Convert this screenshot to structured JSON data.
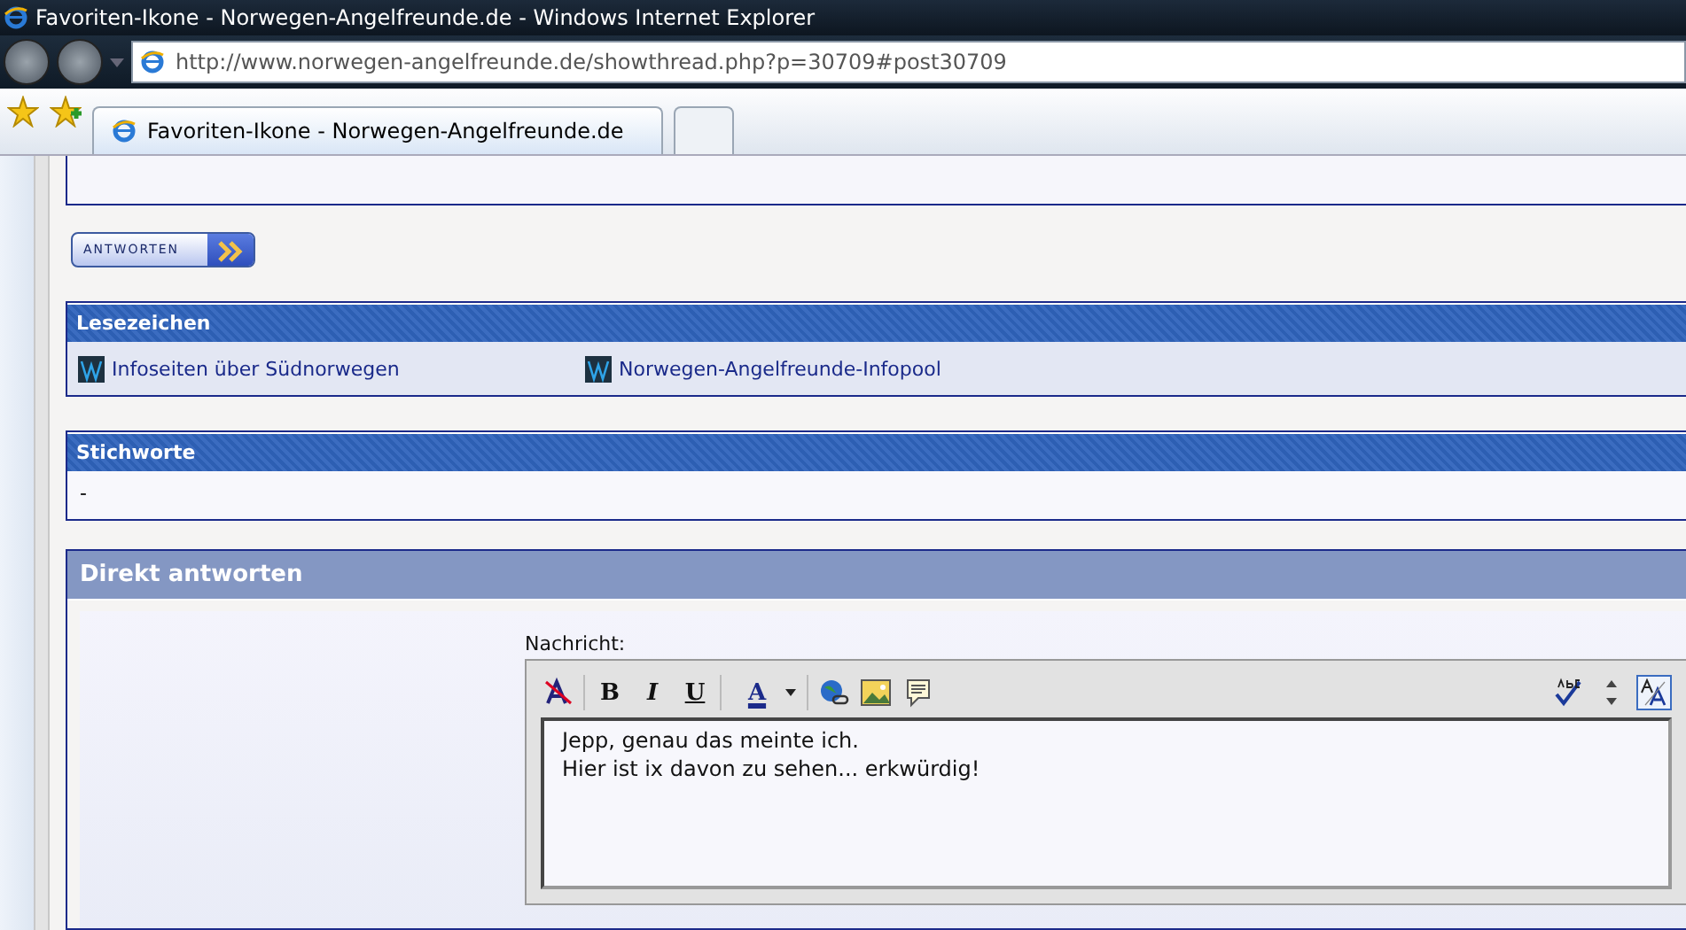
{
  "window": {
    "title": "Favoriten-Ikone - Norwegen-Angelfreunde.de - Windows Internet Explorer"
  },
  "address": {
    "url": "http://www.norwegen-angelfreunde.de/showthread.php?p=30709#post30709"
  },
  "tabs": [
    {
      "label": "Favoriten-Ikone - Norwegen-Angelfreunde.de",
      "selected": true
    },
    {
      "selected": false
    }
  ],
  "reply_button": {
    "label": "ANTWORTEN"
  },
  "bookmarks": {
    "title": "Lesezeichen",
    "items": [
      {
        "label": "Infoseiten über Südnorwegen"
      },
      {
        "label": "Norwegen-Angelfreunde-Infopool"
      }
    ]
  },
  "tags": {
    "title": "Stichworte",
    "value": "-"
  },
  "quick_reply": {
    "title": "Direkt antworten",
    "message_label": "Nachricht:",
    "toolbar": [
      {
        "kind": "remove-format"
      },
      {
        "kind": "sep"
      },
      {
        "kind": "bold",
        "label": "B"
      },
      {
        "kind": "italic",
        "label": "I"
      },
      {
        "kind": "underline",
        "label": "U"
      },
      {
        "kind": "sep"
      },
      {
        "kind": "color",
        "label": "A"
      },
      {
        "kind": "sep"
      },
      {
        "kind": "link"
      },
      {
        "kind": "image"
      },
      {
        "kind": "quote"
      }
    ],
    "right_tools": [
      {
        "kind": "spell",
        "pressed": false
      },
      {
        "kind": "resize",
        "pressed": false
      },
      {
        "kind": "mode",
        "pressed": true
      }
    ],
    "message_lines": [
      "Jepp, genau das meinte ich.",
      "Hier ist ix davon zu sehen... erkwürdig!"
    ]
  }
}
